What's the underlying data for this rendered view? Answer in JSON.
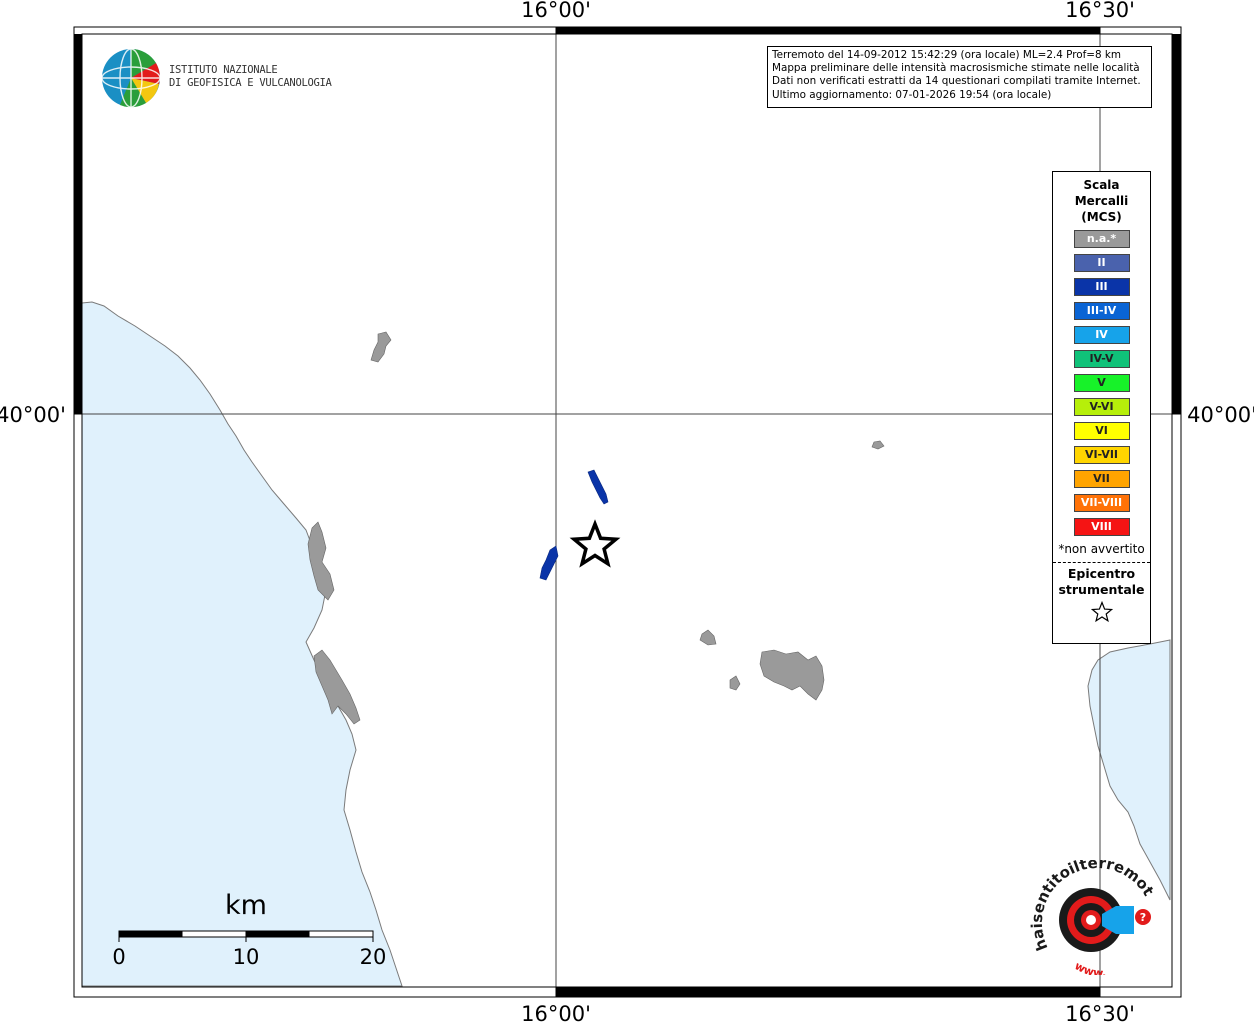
{
  "header": {
    "org_line1": "ISTITUTO NAZIONALE",
    "org_line2": "DI GEOFISICA E VULCANOLOGIA"
  },
  "info": {
    "line1": "Terremoto del 14-09-2012 15:42:29 (ora locale) ML=2.4 Prof=8 km",
    "line2": "Mappa preliminare delle intensità macrosismiche stimate nelle località",
    "line3": "Dati non verificati estratti da 14 questionari compilati tramite Internet.",
    "line4": "Ultimo aggiornamento: 07-01-2026 19:54 (ora locale)"
  },
  "axes": {
    "lon_ticks": [
      "16°00'",
      "16°30'"
    ],
    "lat_ticks": [
      "40°00'"
    ]
  },
  "legend": {
    "title_line1": "Scala",
    "title_line2": "Mercalli",
    "title_line3": "(MCS)",
    "items": [
      {
        "label": "n.a.*",
        "color": "#9a9a9a"
      },
      {
        "label": "II",
        "color": "#4a62ad"
      },
      {
        "label": "III",
        "color": "#0a34a8"
      },
      {
        "label": "III-IV",
        "color": "#0a64d4"
      },
      {
        "label": "IV",
        "color": "#16a3ea"
      },
      {
        "label": "IV-V",
        "color": "#10c279"
      },
      {
        "label": "V",
        "color": "#17f229"
      },
      {
        "label": "V-VI",
        "color": "#b6ef0a"
      },
      {
        "label": "VI",
        "color": "#ffff00"
      },
      {
        "label": "VI-VII",
        "color": "#ffd500"
      },
      {
        "label": "VII",
        "color": "#ffa400"
      },
      {
        "label": "VII-VIII",
        "color": "#ff7207"
      },
      {
        "label": "VIII",
        "color": "#f51414"
      }
    ],
    "note": "*non avvertito",
    "epicenter_line1": "Epicentro",
    "epicenter_line2": "strumentale"
  },
  "scale_bar": {
    "unit": "km",
    "labels": [
      "0",
      "10",
      "20"
    ]
  },
  "logo_haisentito": {
    "text": "haisentitoilterremoto.it",
    "prefix": "www."
  },
  "colors": {
    "sea": "#e0f1fc",
    "coast": "#7a7a7a",
    "not_felt": "#9a9a9a",
    "intensity_III": "#0a34a8"
  }
}
